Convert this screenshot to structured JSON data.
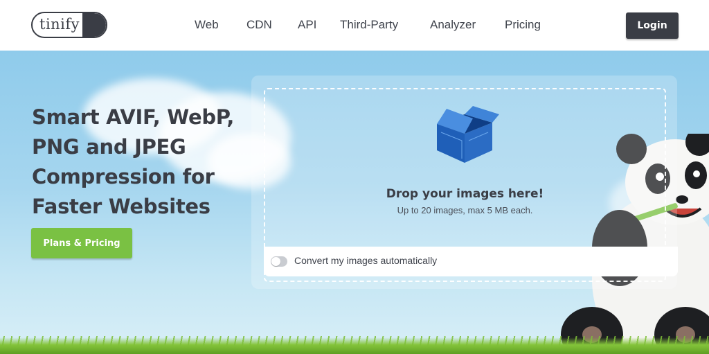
{
  "header": {
    "logo_text": "tinify",
    "nav": [
      "Web",
      "CDN",
      "API",
      "Third-Party",
      "Analyzer",
      "Pricing"
    ],
    "login_label": "Login"
  },
  "hero": {
    "headline_lines": [
      "Smart AVIF, WebP,",
      "PNG and JPEG",
      "Compression for",
      "Faster Websites"
    ],
    "plans_button": "Plans & Pricing"
  },
  "dropzone": {
    "icon": "open-box-icon",
    "title": "Drop your images here!",
    "subtitle": "Up to 20 images, max 5 MB each.",
    "convert_label": "Convert my images automatically",
    "convert_enabled": false
  },
  "colors": {
    "dark": "#3a3d45",
    "accent_green": "#7ac143",
    "sky": "#8fcbeb",
    "box_blue": "#2b6cc4"
  }
}
